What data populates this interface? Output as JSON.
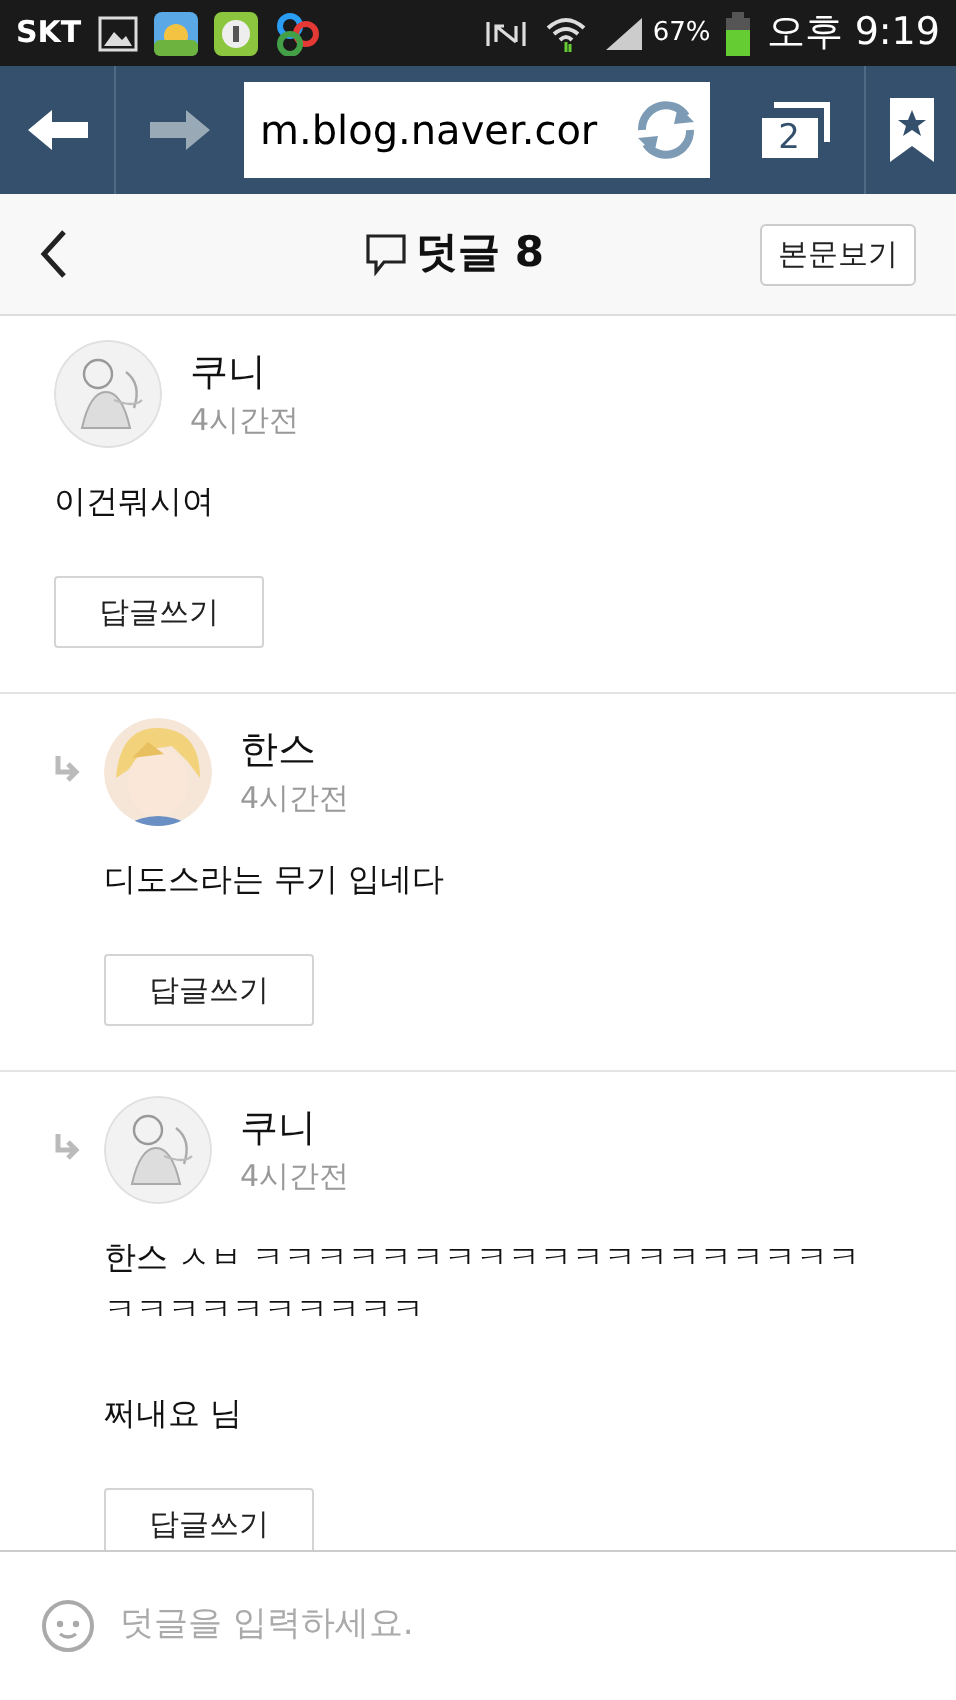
{
  "status_bar": {
    "carrier": "SKT",
    "battery": "67%",
    "time": "오후 9:19"
  },
  "browser": {
    "url": "m.blog.naver.cor",
    "tab_count": "2"
  },
  "header": {
    "title": "덧글 8",
    "view_post": "본문보기"
  },
  "comments": [
    {
      "author": "쿠니",
      "time": "4시간전",
      "reply": false,
      "paragraphs": [
        "이건뭐시여"
      ],
      "reply_button": "답글쓰기"
    },
    {
      "author": "한스",
      "time": "4시간전",
      "reply": true,
      "paragraphs": [
        "디도스라는 무기 입네다"
      ],
      "reply_button": "답글쓰기"
    },
    {
      "author": "쿠니",
      "time": "4시간전",
      "reply": true,
      "paragraphs": [
        "한스 ㅅㅂ ㅋㅋㅋㅋㅋㅋㅋㅋㅋㅋㅋㅋㅋㅋㅋㅋㅋㅋㅋㅋㅋㅋㅋㅋㅋㅋㅋㅋㅋ",
        "쩌내요 님"
      ],
      "reply_button": "답글쓰기"
    }
  ],
  "input": {
    "placeholder": "덧글을 입력하세요."
  }
}
